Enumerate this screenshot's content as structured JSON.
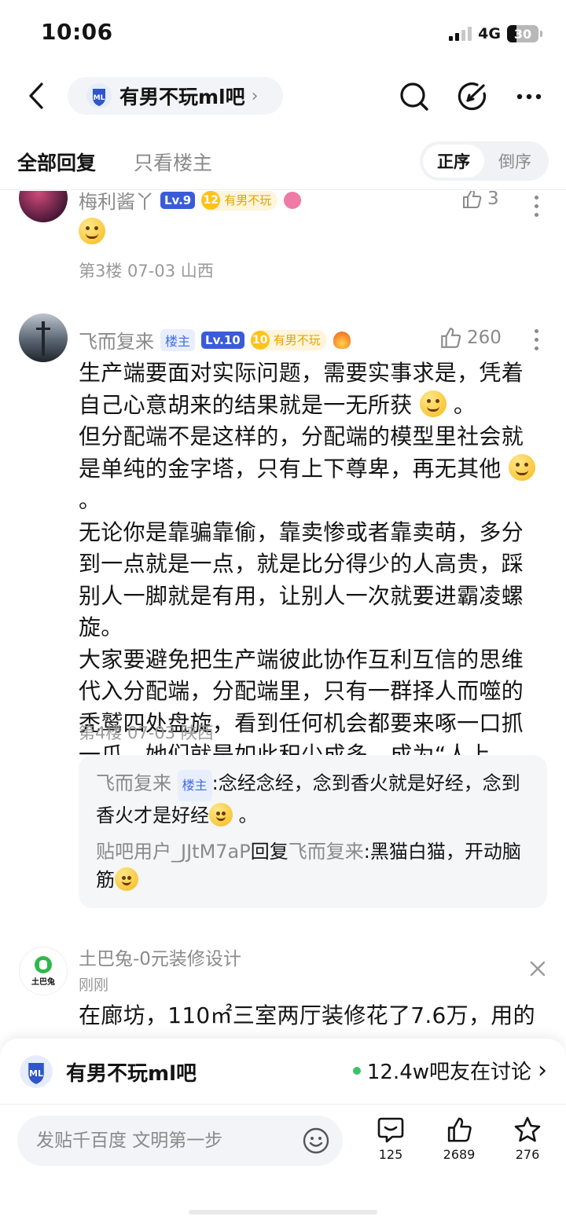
{
  "status_bar": {
    "time": "10:06",
    "network": "4G",
    "battery": "30"
  },
  "nav": {
    "forum_name": "有男不玩ml吧",
    "chevron": "›",
    "icons": [
      "back-icon",
      "search-icon",
      "share-icon",
      "more-icon"
    ]
  },
  "tabs": {
    "all": "全部回复",
    "host_only": "只看楼主"
  },
  "order": {
    "asc": "正序",
    "desc": "倒序"
  },
  "posts": [
    {
      "username": "梅利酱丫",
      "level": "Lv.9",
      "forum_level": "12",
      "forum_badge": "有男不玩",
      "likes": "3",
      "meta": "第3楼 07-03 山西"
    },
    {
      "username": "飞而复来",
      "host_badge": "楼主",
      "level": "Lv.10",
      "forum_level": "10",
      "forum_badge": "有男不玩",
      "likes": "260",
      "body": [
        "生产端要面对实际问题，需要实事求是，凭着自己心意胡来的结果就是一无所获",
        "。",
        "但分配端不是这样的，分配端的模型里社会就是单纯的金字塔，只有上下尊卑，再无其他",
        "。",
        "无论你是靠骗靠偷，靠卖惨或者靠卖萌，多分到一点就是一点，就是比分得少的人高贵，踩别人一脚就是有用，让别人一次就要进霸凌螺旋。",
        "大家要避免把生产端彼此协作互利互信的思维代入分配端，分配端里，只有一群择人而噬的秃鹫四处盘旋，看到任何机会都要来啄一口抓一爪，她们就是如此积少成多，成为“人上人”的",
        "。"
      ],
      "meta": "第4楼 07-03 陕西",
      "replies": [
        {
          "who": "飞而复来",
          "badge": "楼主",
          "text": ":念经念经，念到香火就是好经，念到香火才是好经",
          "tail": "。"
        },
        {
          "who": "贴吧用户_JJtM7aP",
          "verb": "回复",
          "target": "飞而复来",
          "text": ":黑猫白猫，开动脑筋"
        }
      ]
    }
  ],
  "ad": {
    "name": "土巴兔-0元装修设计",
    "time": "刚刚",
    "logo_text": "土巴兔",
    "body": "在廊坊，110㎡三室两厅装修花了7.6万，用的"
  },
  "forum_bar": {
    "name": "有男不玩ml吧",
    "online": "12.4w吧友在讨论",
    "chevron": "›"
  },
  "bottom": {
    "placeholder": "发贴千百度 文明第一步",
    "comments": "125",
    "likes": "2689",
    "favorites": "276"
  },
  "colors": {
    "accent_blue": "#3a5bd9",
    "badge_gold": "#ffc21a",
    "online_green": "#3cc36a",
    "text_gray": "#8a8a8a"
  }
}
